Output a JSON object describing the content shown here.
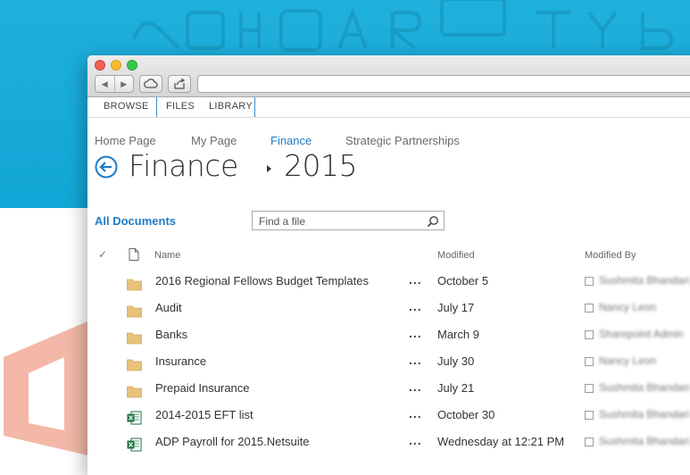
{
  "ribbon": {
    "tabs": [
      "BROWSE",
      "FILES",
      "LIBRARY"
    ]
  },
  "breadcrumb": {
    "items": [
      "Home Page",
      "My Page",
      "Finance",
      "Strategic Partnerships"
    ],
    "active_index": 2
  },
  "title": {
    "site": "Finance",
    "folder": "2015"
  },
  "view": {
    "label": "All Documents"
  },
  "search": {
    "placeholder": "Find a file"
  },
  "columns": {
    "name": "Name",
    "modified": "Modified",
    "modified_by": "Modified By"
  },
  "rows": [
    {
      "type": "folder",
      "name": "2016 Regional Fellows Budget Templates",
      "modified": "October 5",
      "modified_by": "Sushmita Bhandari"
    },
    {
      "type": "folder",
      "name": "Audit",
      "modified": "July 17",
      "modified_by": "Nancy Leon"
    },
    {
      "type": "folder",
      "name": "Banks",
      "modified": "March 9",
      "modified_by": "Sharepoint Admin"
    },
    {
      "type": "folder",
      "name": "Insurance",
      "modified": "July 30",
      "modified_by": "Nancy Leon"
    },
    {
      "type": "folder",
      "name": "Prepaid Insurance",
      "modified": "July 21",
      "modified_by": "Sushmita Bhandari"
    },
    {
      "type": "excel",
      "name": "2014-2015 EFT list",
      "modified": "October 30",
      "modified_by": "Sushmita Bhandari"
    },
    {
      "type": "excel",
      "name": "ADP Payroll for 2015.Netsuite",
      "modified": "Wednesday at 12:21 PM",
      "modified_by": "Sushmita Bhandari"
    }
  ],
  "more_actions_label": "...",
  "colors": {
    "accent": "#1e7bc6",
    "background": "#12a6d6",
    "folder": "#e8c27a",
    "excel": "#1f7244"
  }
}
